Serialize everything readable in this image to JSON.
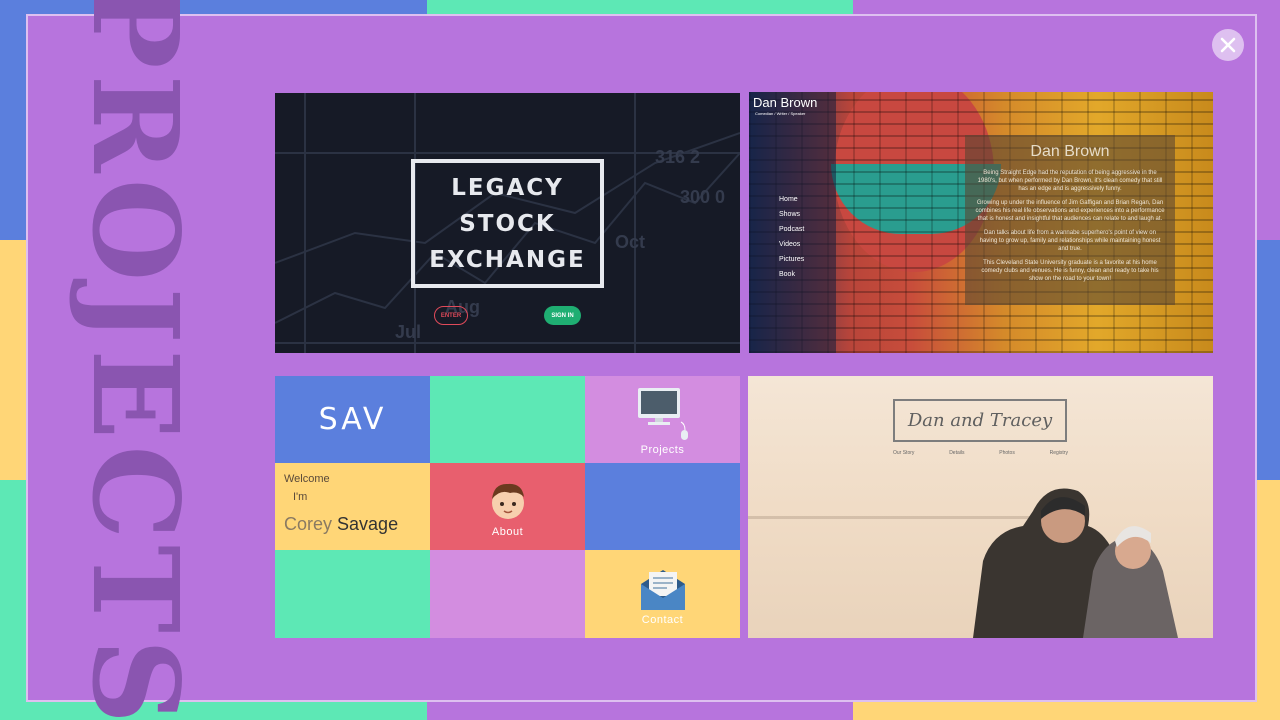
{
  "modal": {
    "title": "PROJECTS",
    "close_icon": "close-icon"
  },
  "stock": {
    "line1": "LEGACY",
    "line2": "STOCK",
    "line3": "EXCHANGE",
    "enter": "ENTER",
    "signin": "SIGN IN"
  },
  "danbrown": {
    "title": "Dan Brown",
    "subtitle": "Comedian / Writer / Speaker",
    "nav": [
      "Home",
      "Shows",
      "Podcast",
      "Videos",
      "Pictures",
      "Book"
    ],
    "panel_title": "Dan Brown",
    "paragraphs": [
      "Being Straight Edge had the reputation of being aggressive in the 1980's, but when performed by Dan Brown, it's clean comedy that still has an edge and is aggressively funny.",
      "Growing up under the influence of Jim Gaffigan and Brian Regan, Dan combines his real life observations and experiences into a performance that is honest and insightful that audiences can relate to and laugh at.",
      "Dan talks about life from a wannabe superhero's point of view on having to grow up, family and relationships while maintaining honest and true.",
      "This Cleveland State University graduate is a favorite at his home comedy clubs and venues. He is funny, clean and ready to take his show on the road to your town!"
    ]
  },
  "savgrid": {
    "logo": "SAV",
    "projects": "Projects",
    "welcome": "Welcome",
    "im": "I'm",
    "first_name": "Corey",
    "last_name": "Savage",
    "about": "About",
    "contact": "Contact"
  },
  "wedding": {
    "title": "Dan and Tracey",
    "nav": [
      "Our Story",
      "Details",
      "Photos",
      "Registry"
    ]
  },
  "colors": {
    "purple": "#b774dd",
    "blue": "#5b7fdd",
    "green": "#5de8b5",
    "yellow": "#ffd677",
    "red": "#e85f6e"
  }
}
